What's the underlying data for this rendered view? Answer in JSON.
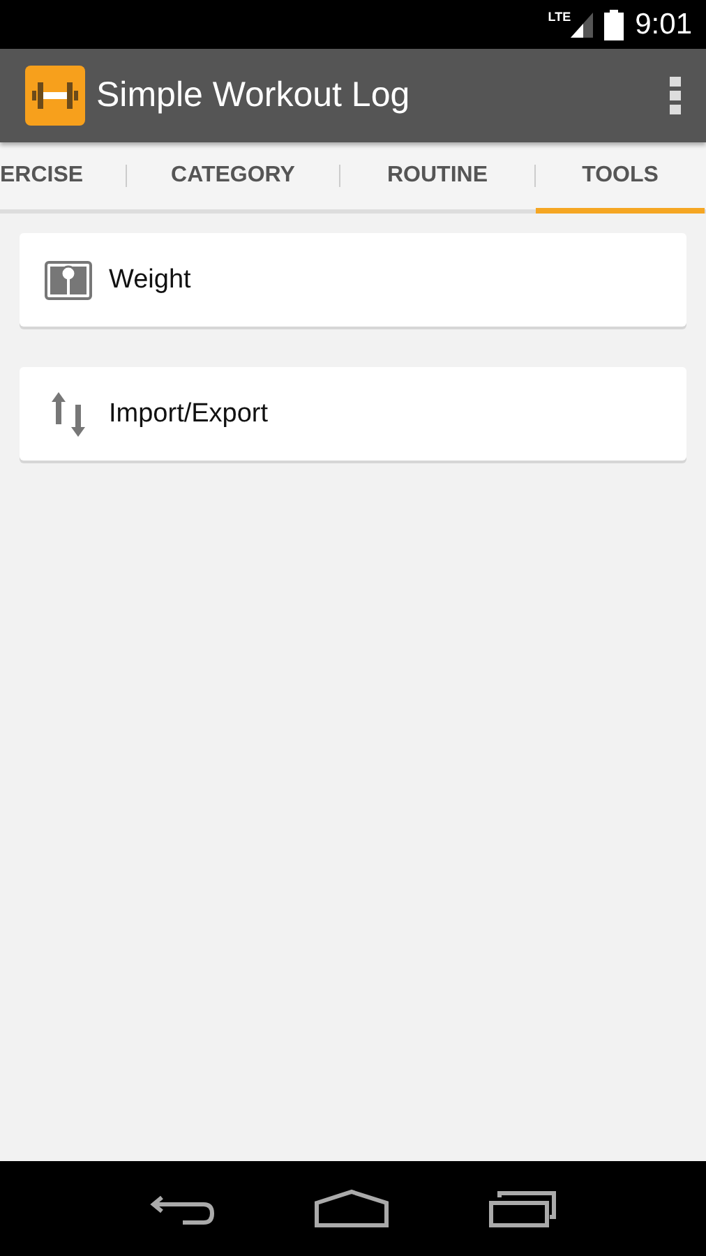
{
  "status_bar": {
    "network": "LTE",
    "time": "9:01"
  },
  "app_bar": {
    "title": "Simple Workout Log"
  },
  "tabs": [
    {
      "label": "ERCISE",
      "selected": false
    },
    {
      "label": "CATEGORY",
      "selected": false
    },
    {
      "label": "ROUTINE",
      "selected": false
    },
    {
      "label": "TOOLS",
      "selected": true
    }
  ],
  "tools": [
    {
      "label": "Weight"
    },
    {
      "label": "Import/Export"
    }
  ]
}
